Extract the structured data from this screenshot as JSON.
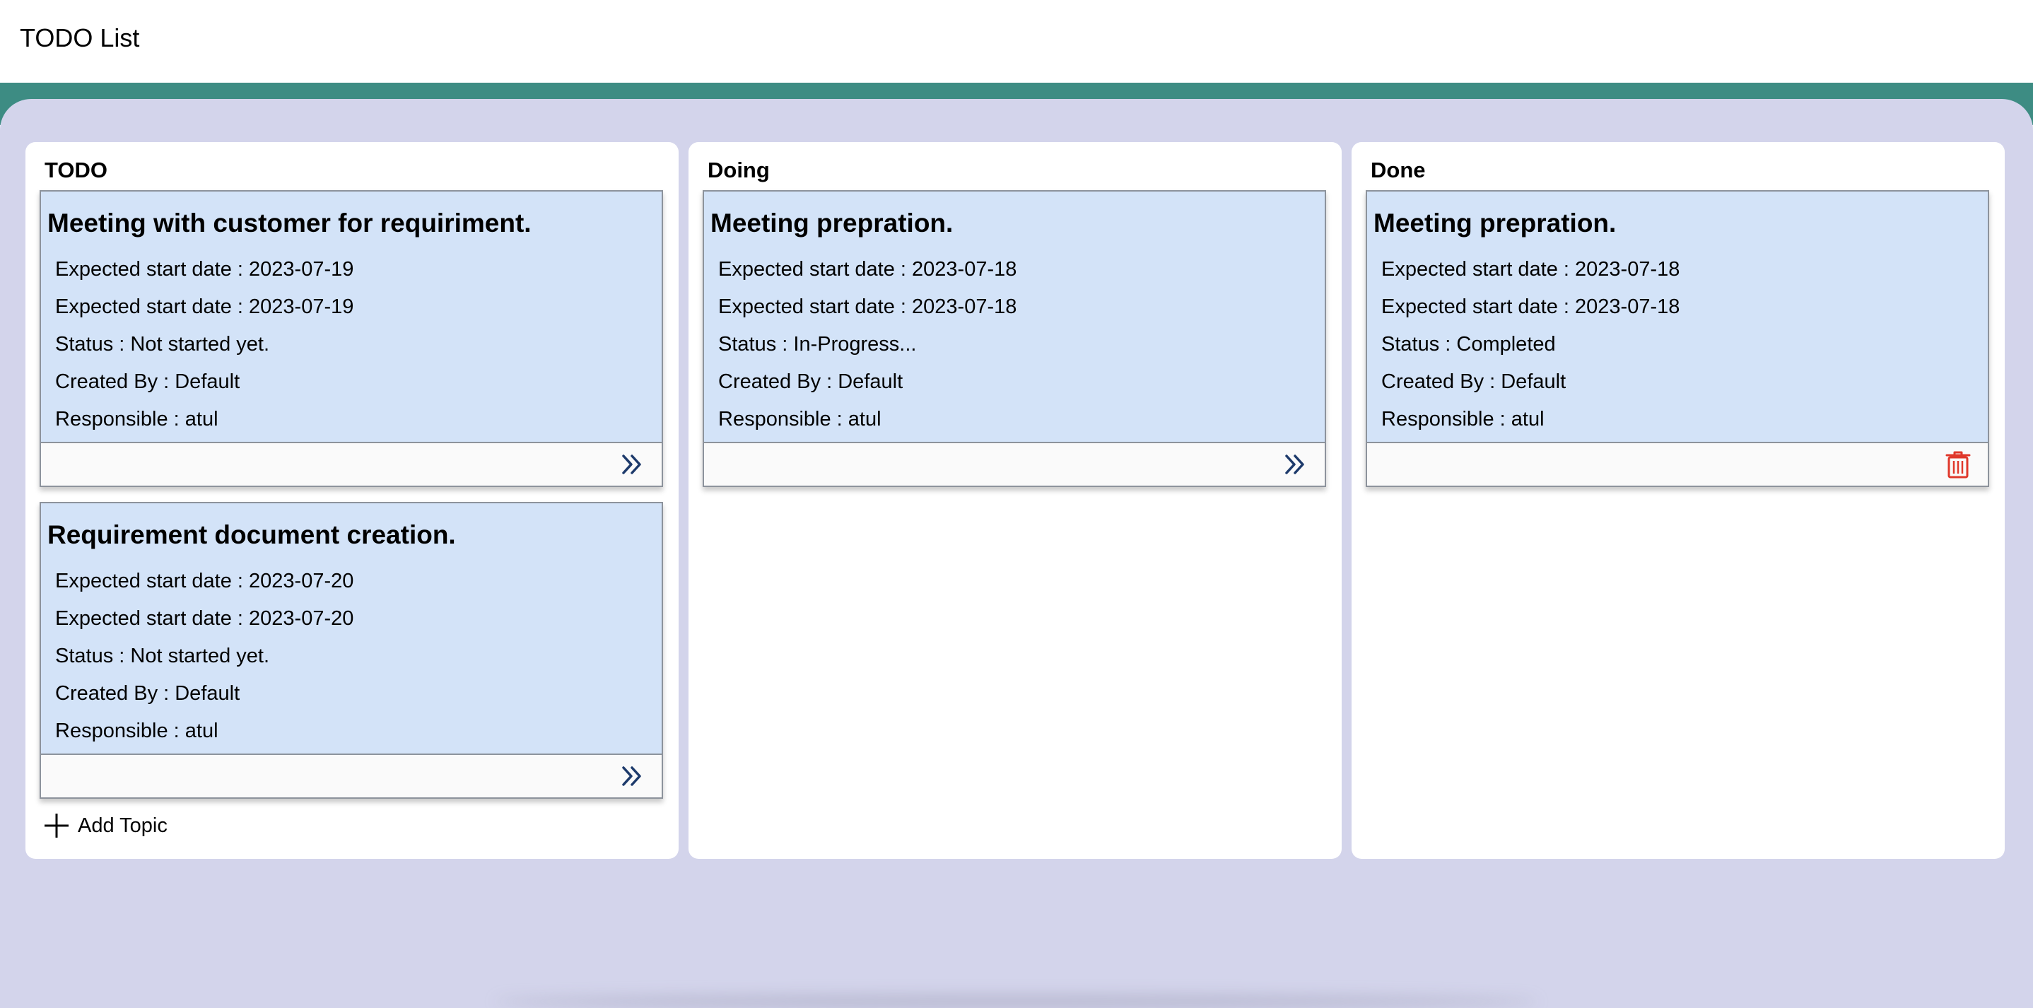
{
  "app": {
    "title": "TODO List"
  },
  "colors": {
    "header_bg": "#ffffff",
    "band": "#3d8c83",
    "board_bg": "#d3d4eb",
    "column_bg": "#ffffff",
    "card_bg": "#d3e3f8",
    "card_footer_bg": "#fafafa",
    "move_icon": "#1d3a6b",
    "delete_icon": "#e0382b"
  },
  "columns": [
    {
      "title": "TODO",
      "cards": [
        {
          "title": "Meeting with customer for requiriment.",
          "field1": "Expected start date : 2023-07-19",
          "field2": "Expected start date : 2023-07-19",
          "status": "Status : Not started yet.",
          "created_by": "Created By : Default",
          "responsible": "Responsible : atul",
          "action_icon": "double-chevron-right-icon"
        },
        {
          "title": "Requirement document creation.",
          "field1": "Expected start date : 2023-07-20",
          "field2": "Expected start date : 2023-07-20",
          "status": "Status : Not started yet.",
          "created_by": "Created By : Default",
          "responsible": "Responsible : atul",
          "action_icon": "double-chevron-right-icon"
        }
      ],
      "add_topic_label": "Add Topic",
      "add_topic_icon": "plus-icon"
    },
    {
      "title": "Doing",
      "cards": [
        {
          "title": "Meeting prepration.",
          "field1": "Expected start date : 2023-07-18",
          "field2": "Expected start date : 2023-07-18",
          "status": "Status : In-Progress...",
          "created_by": "Created By : Default",
          "responsible": "Responsible : atul",
          "action_icon": "double-chevron-right-icon"
        }
      ]
    },
    {
      "title": "Done",
      "cards": [
        {
          "title": "Meeting prepration.",
          "field1": "Expected start date : 2023-07-18",
          "field2": "Expected start date : 2023-07-18",
          "status": "Status : Completed",
          "created_by": "Created By : Default",
          "responsible": "Responsible : atul",
          "action_icon": "trash-icon"
        }
      ]
    }
  ]
}
